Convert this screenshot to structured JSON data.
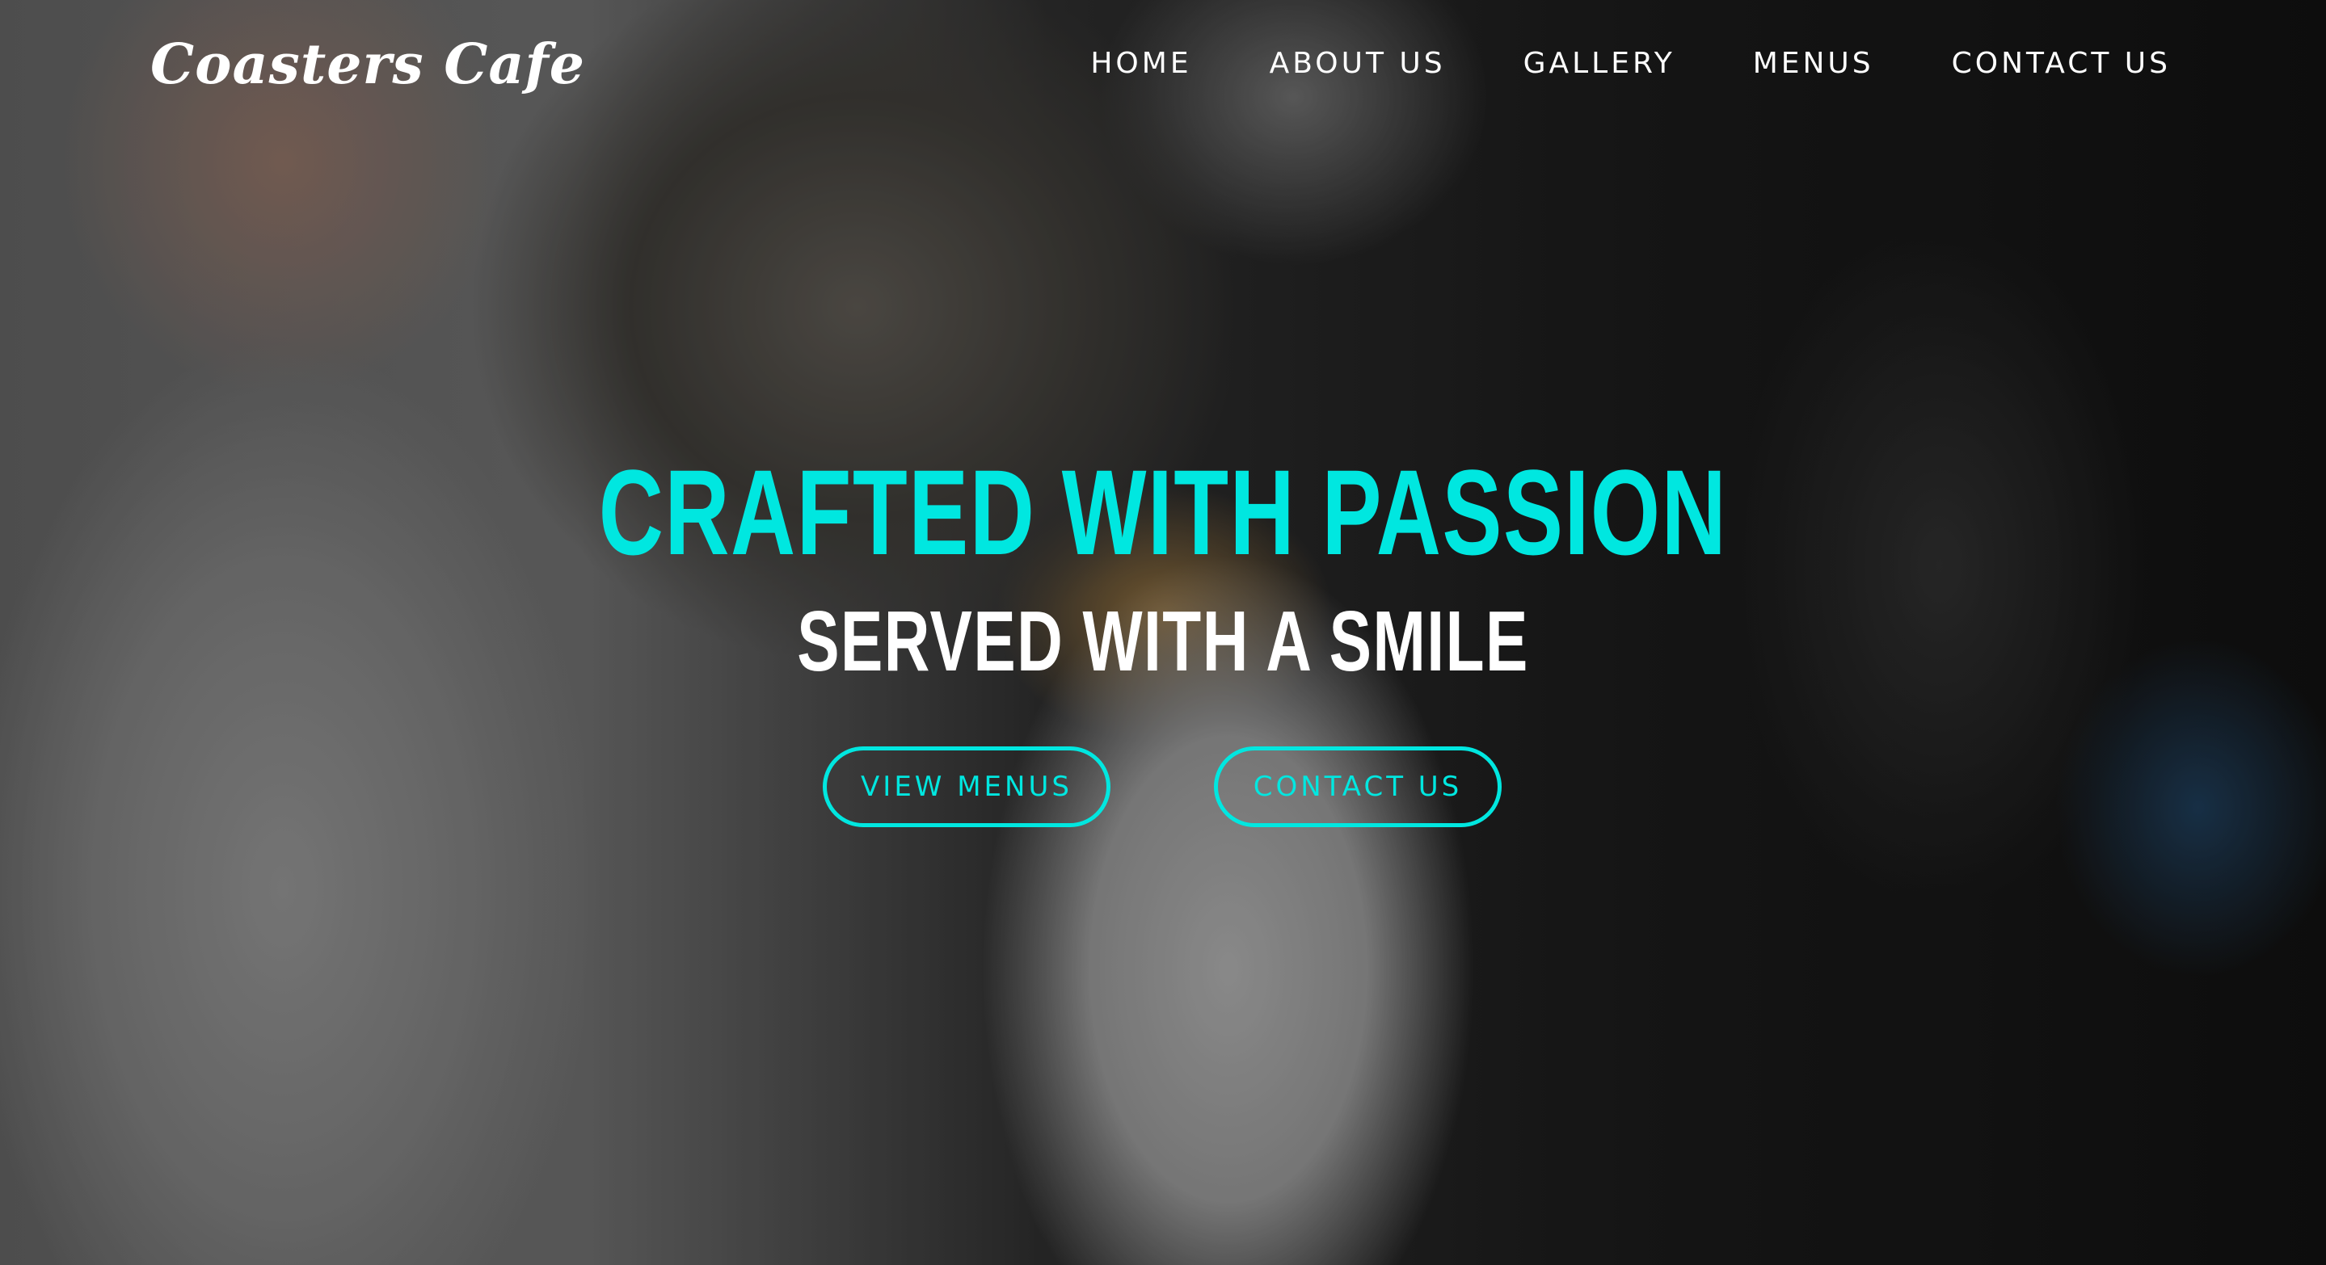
{
  "brand": {
    "logo_text": "Coasters Cafe"
  },
  "nav": {
    "items": [
      {
        "label": "HOME"
      },
      {
        "label": "ABOUT US"
      },
      {
        "label": "GALLERY"
      },
      {
        "label": "MENUS"
      },
      {
        "label": "CONTACT US"
      }
    ]
  },
  "hero": {
    "headline": "CRAFTED WITH PASSION",
    "subheadline": "SERVED WITH A SMILE",
    "buttons": {
      "view_menus": "VIEW MENUS",
      "contact_us": "CONTACT US"
    }
  },
  "colors": {
    "accent": "#00e7e0",
    "text": "#ffffff"
  }
}
